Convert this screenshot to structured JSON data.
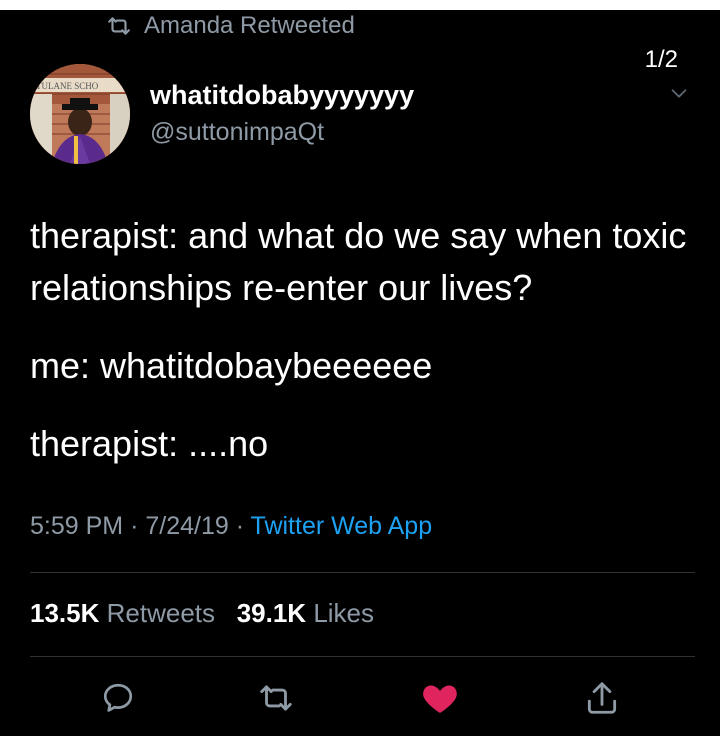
{
  "retweet_banner": "Amanda Retweeted",
  "page_indicator": "1/2",
  "author": {
    "display_name": "whatitdobabyyyyyyy",
    "handle": "@suttonimpaQt",
    "avatar_sign_text": "TULANE SCHO"
  },
  "tweet_lines": [
    "therapist: and what do we say when toxic relationships re-enter our lives?",
    "me: whatitdobaybeeeeee",
    "therapist: ....no"
  ],
  "meta": {
    "time": "5:59 PM",
    "date": "7/24/19",
    "separator": "·",
    "source": "Twitter Web App"
  },
  "stats": {
    "retweets_count": "13.5K",
    "retweets_label": "Retweets",
    "likes_count": "39.1K",
    "likes_label": "Likes"
  },
  "icons": {
    "reply": "reply-icon",
    "retweet": "retweet-icon",
    "like": "heart-icon",
    "share": "share-icon"
  },
  "colors": {
    "background": "#000000",
    "muted": "#8e9aa5",
    "link": "#1da1f2",
    "like": "#e0245e"
  }
}
